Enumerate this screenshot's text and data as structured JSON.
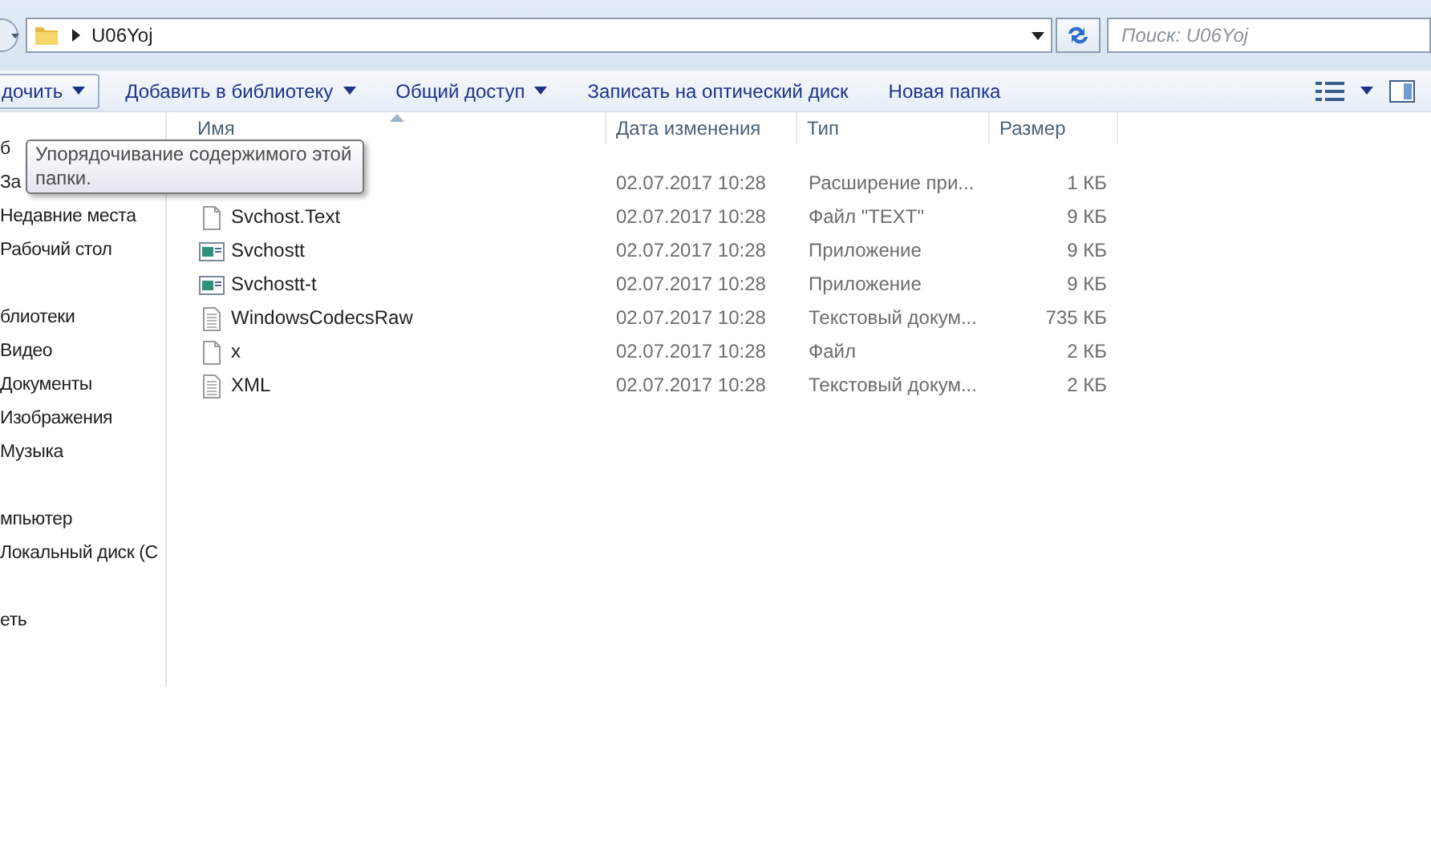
{
  "address": {
    "path": "U06Yoj"
  },
  "search": {
    "placeholder": "Поиск: U06Yoj"
  },
  "toolbar": {
    "buttons": [
      {
        "label": "дочить",
        "dropdown": true,
        "hovered": true
      },
      {
        "label": "Добавить в библиотеку",
        "dropdown": true,
        "hovered": false
      },
      {
        "label": "Общий доступ",
        "dropdown": true,
        "hovered": false
      },
      {
        "label": "Записать на оптический диск",
        "dropdown": false,
        "hovered": false
      },
      {
        "label": "Новая папка",
        "dropdown": false,
        "hovered": false
      }
    ]
  },
  "sidebar": {
    "groups": [
      {
        "items": [
          "б",
          "За",
          "Недавние места",
          "Рабочий стол"
        ]
      },
      {
        "items": [
          "блиотеки",
          "Видео",
          "Документы",
          "Изображения",
          "Музыка"
        ]
      },
      {
        "items": [
          "мпьютер",
          "Локальный диск (С"
        ]
      },
      {
        "items": [
          "еть"
        ]
      }
    ]
  },
  "tooltip": {
    "text": "Упорядочивание содержимого этой папки."
  },
  "table": {
    "columns": [
      {
        "label": "Имя",
        "sorted": true
      },
      {
        "label": "Дата изменения",
        "sorted": false
      },
      {
        "label": "Тип",
        "sorted": false
      },
      {
        "label": "Размер",
        "sorted": false
      }
    ],
    "rows": [
      {
        "kind": "none",
        "date": "02.07.2017 10:28",
        "type": "Расширение при...",
        "size": "1 КБ"
      },
      {
        "kind": "file",
        "name": "Svchost.Text",
        "date": "02.07.2017 10:28",
        "type": "Файл \"TEXT\"",
        "size": "9 КБ"
      },
      {
        "kind": "app",
        "name": "Svchostt",
        "date": "02.07.2017 10:28",
        "type": "Приложение",
        "size": "9 КБ"
      },
      {
        "kind": "app",
        "name": "Svchostt-t",
        "date": "02.07.2017 10:28",
        "type": "Приложение",
        "size": "9 КБ"
      },
      {
        "kind": "text",
        "name": "WindowsCodecsRaw",
        "date": "02.07.2017 10:28",
        "type": "Текстовый докум...",
        "size": "735 КБ"
      },
      {
        "kind": "file",
        "name": "x",
        "date": "02.07.2017 10:28",
        "type": "Файл",
        "size": "2 КБ"
      },
      {
        "kind": "text",
        "name": "XML",
        "date": "02.07.2017 10:28",
        "type": "Текстовый докум...",
        "size": "2 КБ"
      }
    ]
  }
}
